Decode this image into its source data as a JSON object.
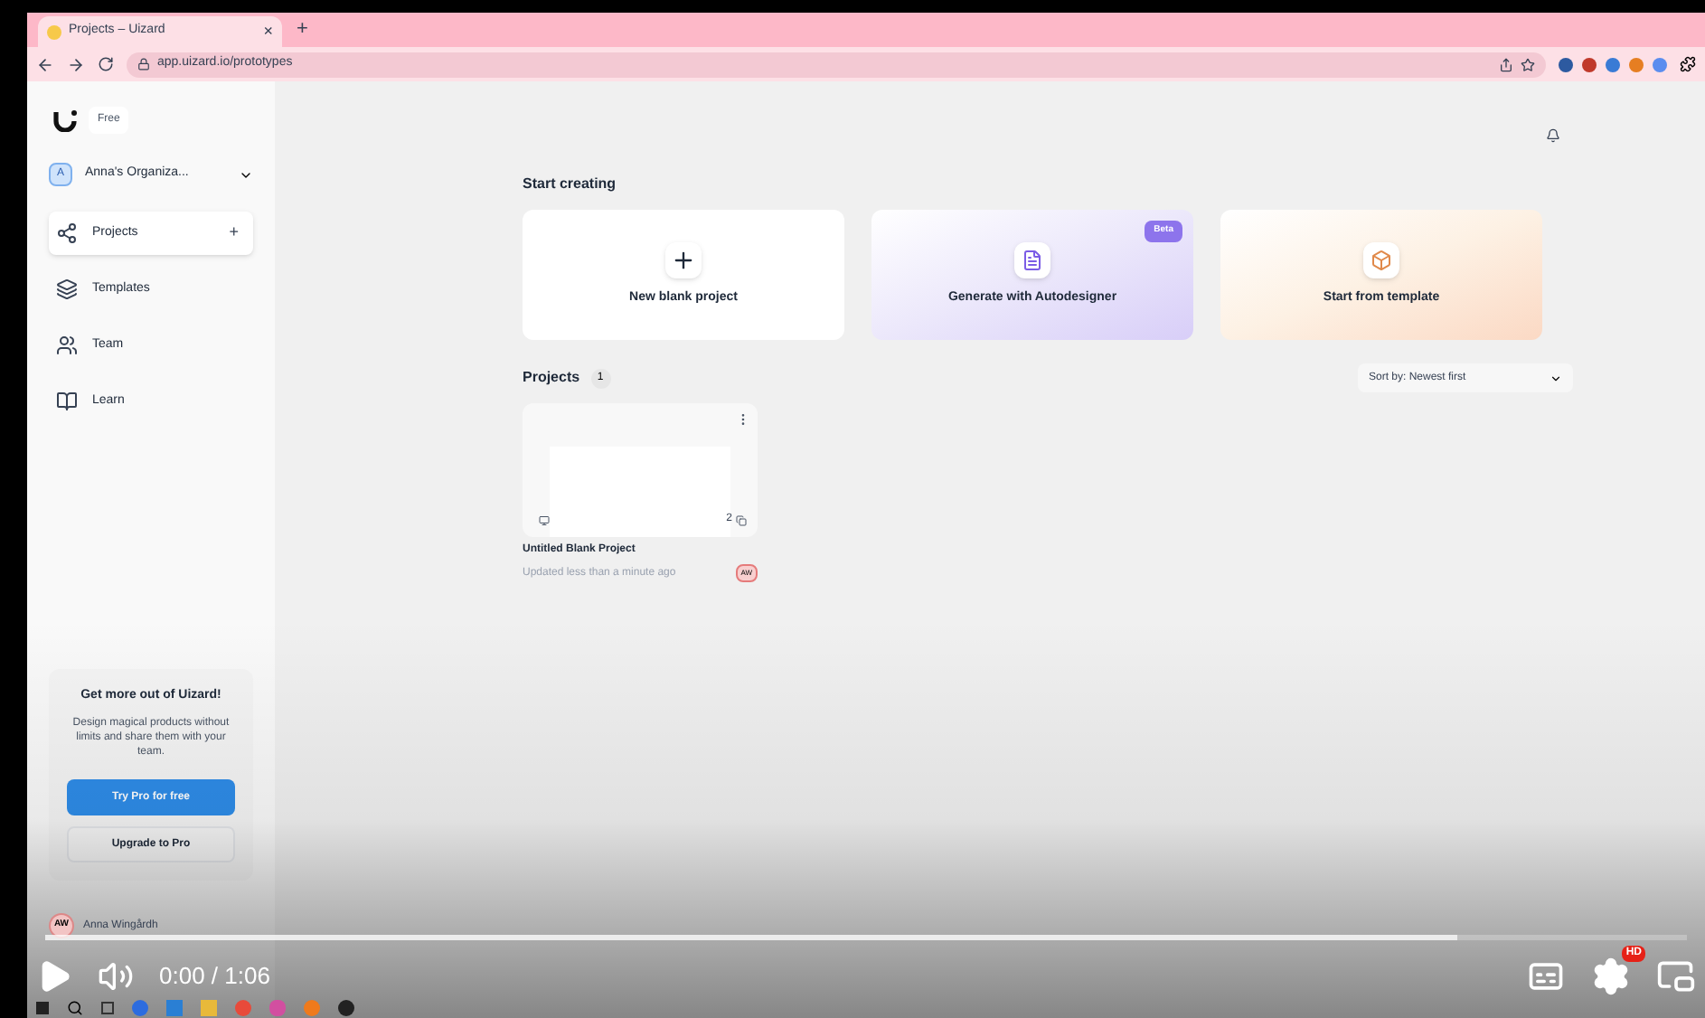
{
  "browser": {
    "tab": {
      "title": "Projects – Uizard",
      "close": "×"
    },
    "new_tab": "+",
    "url": "app.uizard.io/prototypes"
  },
  "sidebar": {
    "plan": "Free",
    "org": {
      "initial": "A",
      "name": "Anna's Organiza..."
    },
    "items": [
      {
        "label": "Projects",
        "selected": true,
        "add": "+",
        "kind": "projects"
      },
      {
        "label": "Templates",
        "selected": false,
        "kind": "templates"
      },
      {
        "label": "Team",
        "selected": false,
        "kind": "team"
      },
      {
        "label": "Learn",
        "selected": false,
        "kind": "learn"
      }
    ],
    "promo": {
      "title": "Get more out of Uizard!",
      "body": "Design magical products without limits and share them with your team.",
      "primary": "Try Pro for free",
      "secondary": "Upgrade to Pro"
    },
    "user": {
      "initials": "AW",
      "name": "Anna Wingårdh"
    }
  },
  "main": {
    "start_title": "Start creating",
    "cards": [
      {
        "kind": "blank",
        "label": "New blank project"
      },
      {
        "kind": "ai",
        "label": "Generate with Autodesigner",
        "badge": "Beta"
      },
      {
        "kind": "template",
        "label": "Start from template"
      }
    ],
    "projects_title": "Projects",
    "projects_count": "1",
    "sort": "Sort by: Newest first",
    "projects": [
      {
        "title": "Untitled Blank Project",
        "updated": "Updated less than a minute ago",
        "pages": "2",
        "owner": "AW"
      }
    ]
  },
  "video": {
    "time": "0:00 / 1:06",
    "hd": "HD"
  }
}
